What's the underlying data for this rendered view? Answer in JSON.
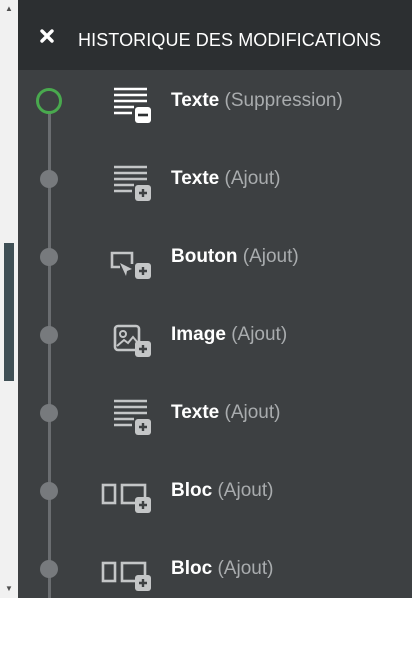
{
  "header": {
    "title": "HISTORIQUE DES MODIFICATIONS",
    "close_icon": "close-icon"
  },
  "scrollbar": {
    "up_arrow": "▲",
    "down_arrow": "▼"
  },
  "colors": {
    "panel_background": "#3d4042",
    "header_background": "#2c2f31",
    "active_node": "#49a94e",
    "node": "#777a7d",
    "icon": "#c4c6c7"
  },
  "history": [
    {
      "name": "Texte",
      "kind": "(Suppression)",
      "icon": "text-remove-icon",
      "active": true
    },
    {
      "name": "Texte",
      "kind": "(Ajout)",
      "icon": "text-add-icon",
      "active": false
    },
    {
      "name": "Bouton",
      "kind": "(Ajout)",
      "icon": "button-add-icon",
      "active": false
    },
    {
      "name": "Image",
      "kind": "(Ajout)",
      "icon": "image-add-icon",
      "active": false
    },
    {
      "name": "Texte",
      "kind": "(Ajout)",
      "icon": "text-add-icon",
      "active": false
    },
    {
      "name": "Bloc",
      "kind": "(Ajout)",
      "icon": "block-add-icon",
      "active": false
    },
    {
      "name": "Bloc",
      "kind": "(Ajout)",
      "icon": "block-add-icon",
      "active": false
    }
  ]
}
